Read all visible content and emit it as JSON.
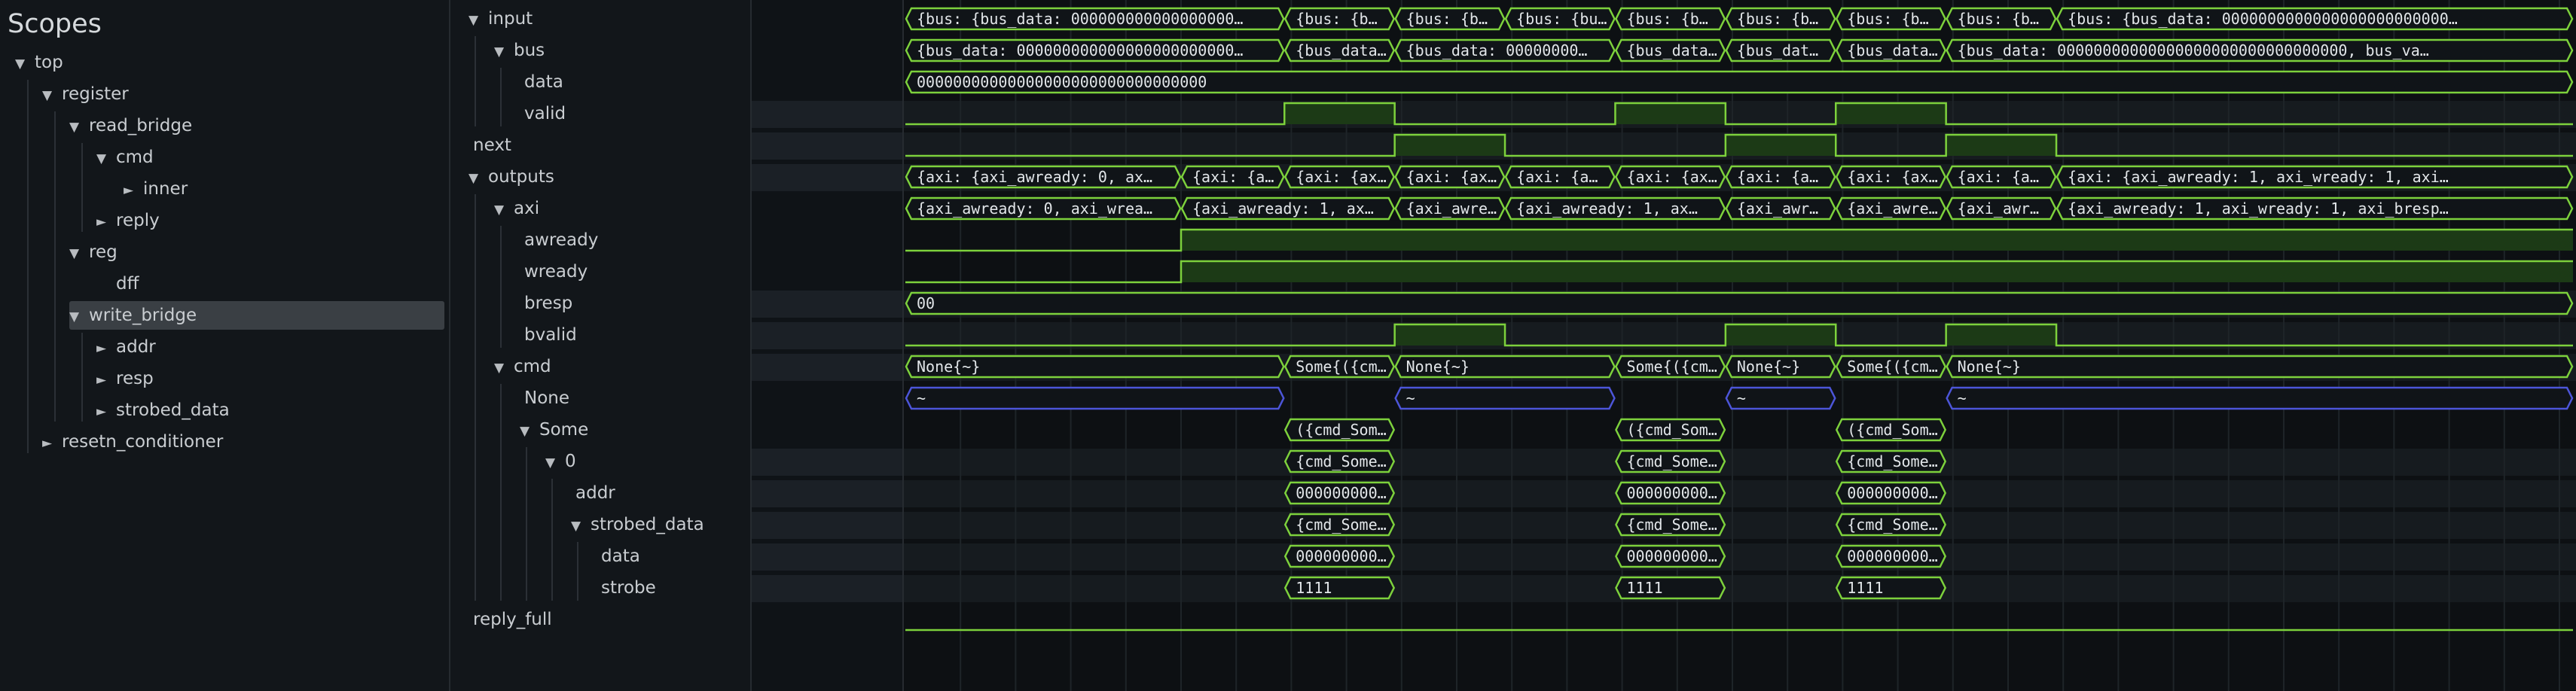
{
  "scopes": {
    "title": "Scopes",
    "items": [
      {
        "label": "top",
        "depth": 0,
        "arrow": "▼"
      },
      {
        "label": "register",
        "depth": 1,
        "arrow": "▼"
      },
      {
        "label": "read_bridge",
        "depth": 2,
        "arrow": "▼"
      },
      {
        "label": "cmd",
        "depth": 3,
        "arrow": "▼"
      },
      {
        "label": "inner",
        "depth": 4,
        "arrow": "►"
      },
      {
        "label": "reply",
        "depth": 3,
        "arrow": "►"
      },
      {
        "label": "reg",
        "depth": 2,
        "arrow": "▼"
      },
      {
        "label": "dff",
        "depth": 3,
        "arrow": ""
      },
      {
        "label": "write_bridge",
        "depth": 2,
        "arrow": "▼",
        "selected": true
      },
      {
        "label": "addr",
        "depth": 3,
        "arrow": "►"
      },
      {
        "label": "resp",
        "depth": 3,
        "arrow": "►"
      },
      {
        "label": "strobed_data",
        "depth": 3,
        "arrow": "►"
      },
      {
        "label": "resetn_conditioner",
        "depth": 1,
        "arrow": "►"
      }
    ]
  },
  "signals": [
    {
      "label": "input",
      "depth": 0,
      "arrow": "▼"
    },
    {
      "label": "bus",
      "depth": 1,
      "arrow": "▼"
    },
    {
      "label": "data",
      "depth": 2,
      "arrow": ""
    },
    {
      "label": "valid",
      "depth": 2,
      "arrow": ""
    },
    {
      "label": "next",
      "depth": 0,
      "arrow": ""
    },
    {
      "label": "outputs",
      "depth": 0,
      "arrow": "▼"
    },
    {
      "label": "axi",
      "depth": 1,
      "arrow": "▼"
    },
    {
      "label": "awready",
      "depth": 2,
      "arrow": ""
    },
    {
      "label": "wready",
      "depth": 2,
      "arrow": ""
    },
    {
      "label": "bresp",
      "depth": 2,
      "arrow": ""
    },
    {
      "label": "bvalid",
      "depth": 2,
      "arrow": ""
    },
    {
      "label": "cmd",
      "depth": 1,
      "arrow": "▼"
    },
    {
      "label": "None",
      "depth": 2,
      "arrow": ""
    },
    {
      "label": "Some",
      "depth": 2,
      "arrow": "▼"
    },
    {
      "label": "0",
      "depth": 3,
      "arrow": "▼"
    },
    {
      "label": "addr",
      "depth": 4,
      "arrow": ""
    },
    {
      "label": "strobed_data",
      "depth": 4,
      "arrow": "▼"
    },
    {
      "label": "data",
      "depth": 5,
      "arrow": ""
    },
    {
      "label": "strobe",
      "depth": 5,
      "arrow": ""
    },
    {
      "label": "reply_full",
      "depth": 0,
      "arrow": ""
    }
  ],
  "waves": {
    "colors": {
      "green": "#7dd13c",
      "blue": "#4c55d9",
      "fill": "#1c3a16",
      "grid": "#1e2428",
      "band": "#161b1f"
    },
    "rows": [
      {
        "type": "bus",
        "segs": [
          [
            0,
            5.5,
            "{bus: {bus_data: 000000000000000000…"
          ],
          [
            5.5,
            7.1,
            "{bus: {b…"
          ],
          [
            7.1,
            8.7,
            "{bus: {b…"
          ],
          [
            8.7,
            10.3,
            "{bus: {bu…"
          ],
          [
            10.3,
            11.9,
            "{bus: {b…"
          ],
          [
            11.9,
            13.5,
            "{bus: {b…"
          ],
          [
            13.5,
            15.1,
            "{bus: {b…"
          ],
          [
            15.1,
            16.7,
            "{bus: {b…"
          ],
          [
            16.7,
            46,
            "{bus: {bus_data: 0000000000000000000000000…"
          ]
        ]
      },
      {
        "type": "bus",
        "segs": [
          [
            0,
            5.5,
            "{bus_data: 000000000000000000000000…"
          ],
          [
            5.5,
            7.1,
            "{bus_data…"
          ],
          [
            7.1,
            10.3,
            "{bus_data: 00000000…"
          ],
          [
            10.3,
            11.9,
            "{bus_data…"
          ],
          [
            11.9,
            13.5,
            "{bus_dat…"
          ],
          [
            13.5,
            15.1,
            "{bus_data…"
          ],
          [
            15.1,
            46,
            "{bus_data: 00000000000000000000000000000000, bus_va…"
          ]
        ]
      },
      {
        "type": "bus",
        "segs": [
          [
            0,
            46,
            "00000000000000000000000000000000"
          ]
        ]
      },
      {
        "type": "bit",
        "high": [
          [
            5.5,
            7.1
          ],
          [
            10.3,
            11.9
          ],
          [
            13.5,
            15.1
          ]
        ]
      },
      {
        "type": "bit",
        "high": [
          [
            7.1,
            8.7
          ],
          [
            11.9,
            13.5
          ],
          [
            15.1,
            16.7
          ]
        ]
      },
      {
        "type": "bus",
        "segs": [
          [
            0,
            4,
            "{axi: {axi_awready: 0, ax…"
          ],
          [
            4,
            5.5,
            "{axi: {a…"
          ],
          [
            5.5,
            7.1,
            "{axi: {ax…"
          ],
          [
            7.1,
            8.7,
            "{axi: {ax…"
          ],
          [
            8.7,
            10.3,
            "{axi: {a…"
          ],
          [
            10.3,
            11.9,
            "{axi: {ax…"
          ],
          [
            11.9,
            13.5,
            "{axi: {a…"
          ],
          [
            13.5,
            15.1,
            "{axi: {ax…"
          ],
          [
            15.1,
            16.7,
            "{axi: {a…"
          ],
          [
            16.7,
            46,
            "{axi: {axi_awready: 1, axi_wready: 1, axi…"
          ]
        ]
      },
      {
        "type": "bus",
        "segs": [
          [
            0,
            4,
            "{axi_awready: 0, axi_wrea…"
          ],
          [
            4,
            7.1,
            "{axi_awready: 1, ax…"
          ],
          [
            7.1,
            8.7,
            "{axi_awre…"
          ],
          [
            8.7,
            11.9,
            "{axi_awready: 1, ax…"
          ],
          [
            11.9,
            13.5,
            "{axi_awr…"
          ],
          [
            13.5,
            15.1,
            "{axi_awre…"
          ],
          [
            15.1,
            16.7,
            "{axi_awr…"
          ],
          [
            16.7,
            46,
            "{axi_awready: 1, axi_wready: 1, axi_bresp…"
          ]
        ]
      },
      {
        "type": "bit",
        "high": [
          [
            4,
            46
          ]
        ]
      },
      {
        "type": "bit",
        "high": [
          [
            4,
            46
          ]
        ]
      },
      {
        "type": "bus",
        "segs": [
          [
            0,
            46,
            "00"
          ]
        ]
      },
      {
        "type": "bit",
        "high": [
          [
            7.1,
            8.7
          ],
          [
            11.9,
            13.5
          ],
          [
            15.1,
            16.7
          ]
        ]
      },
      {
        "type": "bus",
        "segs": [
          [
            0,
            5.5,
            "None{~}"
          ],
          [
            5.5,
            7.1,
            "Some{({cm…"
          ],
          [
            7.1,
            10.3,
            "None{~}"
          ],
          [
            10.3,
            11.9,
            "Some{({cm…"
          ],
          [
            11.9,
            13.5,
            "None{~}"
          ],
          [
            13.5,
            15.1,
            "Some{({cm…"
          ],
          [
            15.1,
            46,
            "None{~}"
          ]
        ]
      },
      {
        "type": "bus",
        "blue": true,
        "segs": [
          [
            0,
            5.5,
            "~"
          ],
          [
            7.1,
            10.3,
            "~"
          ],
          [
            11.9,
            13.5,
            "~"
          ],
          [
            15.1,
            46,
            "~"
          ]
        ]
      },
      {
        "type": "bus",
        "segs": [
          [
            5.5,
            7.1,
            "({cmd_Som…"
          ],
          [
            10.3,
            11.9,
            "({cmd_Som…"
          ],
          [
            13.5,
            15.1,
            "({cmd_Som…"
          ]
        ]
      },
      {
        "type": "bus",
        "segs": [
          [
            5.5,
            7.1,
            "{cmd_Some…"
          ],
          [
            10.3,
            11.9,
            "{cmd_Some…"
          ],
          [
            13.5,
            15.1,
            "{cmd_Some…"
          ]
        ]
      },
      {
        "type": "bus",
        "segs": [
          [
            5.5,
            7.1,
            "000000000…"
          ],
          [
            10.3,
            11.9,
            "000000000…"
          ],
          [
            13.5,
            15.1,
            "000000000…"
          ]
        ]
      },
      {
        "type": "bus",
        "segs": [
          [
            5.5,
            7.1,
            "{cmd_Some…"
          ],
          [
            10.3,
            11.9,
            "{cmd_Some…"
          ],
          [
            13.5,
            15.1,
            "{cmd_Some…"
          ]
        ]
      },
      {
        "type": "bus",
        "segs": [
          [
            5.5,
            7.1,
            "000000000…"
          ],
          [
            10.3,
            11.9,
            "000000000…"
          ],
          [
            13.5,
            15.1,
            "000000000…"
          ]
        ]
      },
      {
        "type": "bus",
        "segs": [
          [
            5.5,
            7.1,
            "1111"
          ],
          [
            10.3,
            11.9,
            "1111"
          ],
          [
            13.5,
            15.1,
            "1111"
          ]
        ]
      },
      {
        "type": "bit",
        "high": []
      }
    ],
    "value_rows": [
      3,
      4,
      5,
      9,
      10,
      11,
      14,
      15,
      16,
      17,
      18
    ]
  }
}
